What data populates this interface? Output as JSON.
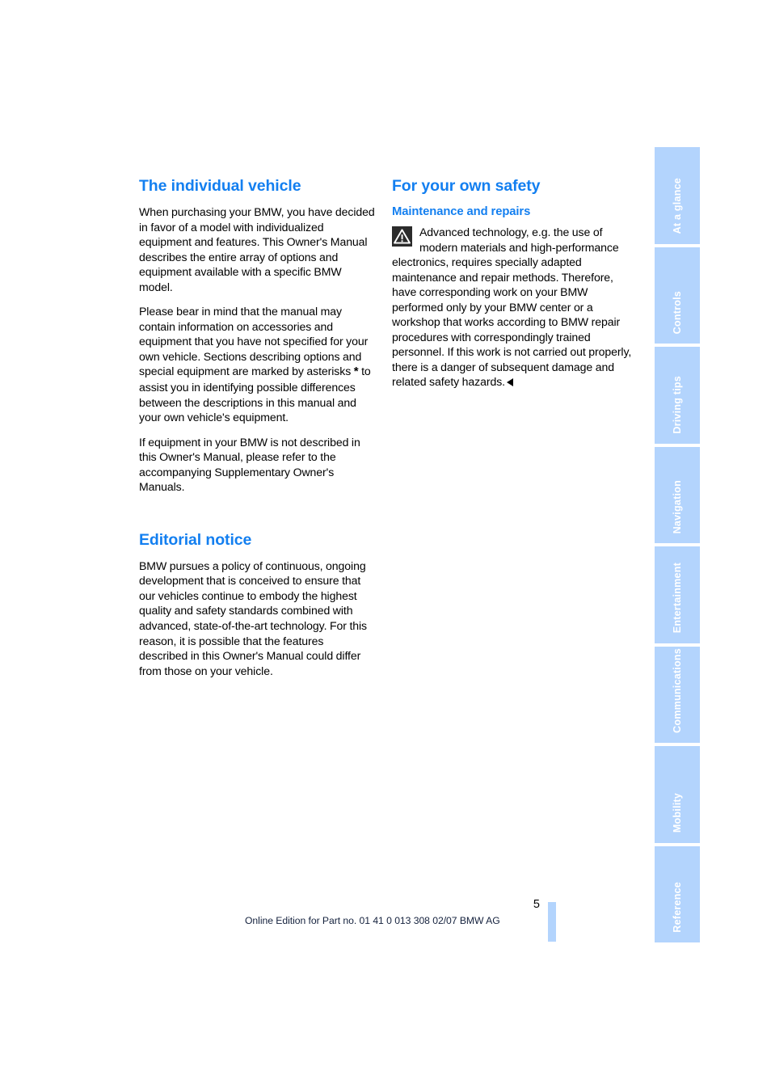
{
  "document": {
    "page_number": "5",
    "footer_note": "Online Edition for Part no. 01 41 0 013 308 02/07 BMW AG"
  },
  "left_column": {
    "section_1": {
      "title": "The individual vehicle",
      "paragraphs": [
        "When purchasing your BMW, you have decided in favor of a model with individualized equipment and features. This Owner's Manual describes the entire array of options and equipment available with a specific BMW model.",
        "Please bear in mind that the manual may contain information on accessories and equipment that you have not specified for your own vehicle. Sections describing options and special equipment are marked by asterisks ",
        "If equipment in your BMW is not described in this Owner's Manual, please refer to the accompanying Supplementary Owner's Manuals."
      ],
      "asterisk_symbol": "*",
      "paragraph_2_continuation": " to assist you in identifying possible differences between the descriptions in this manual and your own vehicle's equipment."
    },
    "section_2": {
      "title": "Editorial notice",
      "paragraphs": [
        "BMW pursues a policy of continuous, ongoing development that is conceived to ensure that our vehicles continue to embody the highest quality and safety standards combined with advanced, state-of-the-art technology. For this reason, it is possible that the features described in this Owner's Manual could differ from those on your vehicle."
      ]
    }
  },
  "right_column": {
    "section_1": {
      "title": "For your own safety",
      "subsection": {
        "title": "Maintenance and repairs",
        "warning_icon": "warning-triangle-icon",
        "text": "Advanced technology, e.g. the use of modern materials and high-performance electronics, requires specially adapted maintenance and repair methods. Therefore, have corresponding work on your BMW performed only by your BMW center or a workshop that works according to BMW repair procedures with correspondingly trained personnel. If this work is not carried out properly, there is a danger of subsequent damage and related safety hazards.",
        "end_marker": "◀"
      }
    }
  },
  "tab_rail": {
    "tabs": [
      {
        "label": "At a glance"
      },
      {
        "label": "Controls"
      },
      {
        "label": "Driving tips"
      },
      {
        "label": "Navigation"
      },
      {
        "label": "Entertainment"
      },
      {
        "label": "Communications"
      },
      {
        "label": "Mobility"
      },
      {
        "label": "Reference"
      }
    ]
  },
  "colors": {
    "heading_blue": "#137ff0",
    "tab_blue": "#b3d4fd",
    "warning_icon_bg": "#2b2b2b",
    "body_text": "#000000",
    "footer_text": "#14213d"
  }
}
